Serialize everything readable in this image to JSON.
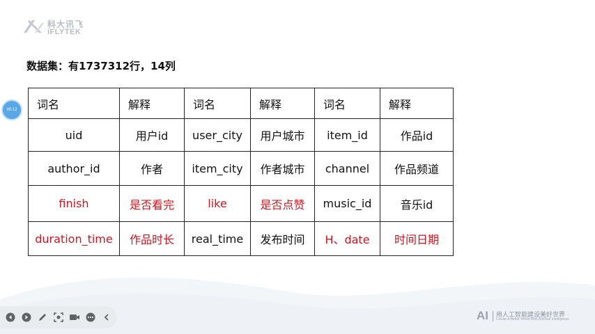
{
  "brand": {
    "name_cn": "科大讯飞",
    "name_en": "iFLYTEK"
  },
  "heading": "数据集：有1737312行，14列",
  "timer": "00:12",
  "table": {
    "col_widths": [],
    "rows": [
      [
        {
          "text": "词名",
          "color": "black",
          "kind": "hdr"
        },
        {
          "text": "解释",
          "color": "black",
          "kind": "hdr"
        },
        {
          "text": "词名",
          "color": "black",
          "kind": "hdr"
        },
        {
          "text": "解释",
          "color": "black",
          "kind": "hdr"
        },
        {
          "text": "词名",
          "color": "black",
          "kind": "hdr"
        },
        {
          "text": "解释",
          "color": "black",
          "kind": "hdr"
        }
      ],
      [
        {
          "text": "uid",
          "color": "black"
        },
        {
          "text": "用户id",
          "color": "black"
        },
        {
          "text": "user_city",
          "color": "black"
        },
        {
          "text": "用户城市",
          "color": "black"
        },
        {
          "text": "item_id",
          "color": "black"
        },
        {
          "text": "作品id",
          "color": "black"
        }
      ],
      [
        {
          "text": "author_id",
          "color": "black"
        },
        {
          "text": "作者",
          "color": "black"
        },
        {
          "text": "item_city",
          "color": "black"
        },
        {
          "text": "作者城市",
          "color": "black"
        },
        {
          "text": "channel",
          "color": "black"
        },
        {
          "text": "作品频道",
          "color": "black"
        }
      ],
      [
        {
          "text": "finish",
          "color": "red"
        },
        {
          "text": "是否看完",
          "color": "red"
        },
        {
          "text": "like",
          "color": "red"
        },
        {
          "text": "是否点赞",
          "color": "red"
        },
        {
          "text": "music_id",
          "color": "black"
        },
        {
          "text": "音乐id",
          "color": "black"
        }
      ],
      [
        {
          "text": "duration_time",
          "color": "red"
        },
        {
          "text": "作品时长",
          "color": "red"
        },
        {
          "text": "real_time",
          "color": "black"
        },
        {
          "text": "发布时间",
          "color": "black"
        },
        {
          "text": "H、date",
          "color": "red"
        },
        {
          "text": "时间日期",
          "color": "red"
        }
      ]
    ]
  },
  "toolbar": {
    "buttons": [
      {
        "name": "prev-slide-icon"
      },
      {
        "name": "next-slide-icon"
      },
      {
        "name": "pen-icon"
      },
      {
        "name": "screen-select-icon"
      },
      {
        "name": "video-icon"
      },
      {
        "name": "more-icon"
      },
      {
        "name": "collapse-icon"
      }
    ]
  },
  "footer": {
    "mark": "AI",
    "slogan": "用人工智能建设美好世界",
    "subtitle": "Create A Better World With Artificial Intelligence"
  },
  "colors": {
    "red": "#d0141e",
    "timer_blue": "#5aa7e8",
    "logo_gray": "#b7bcc2"
  }
}
